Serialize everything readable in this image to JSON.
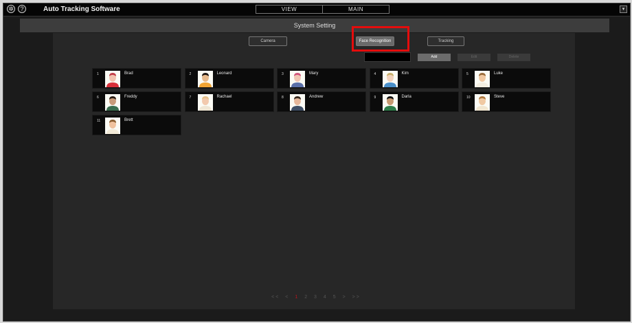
{
  "app": {
    "title": "Auto Tracking Software",
    "icons": [
      "gear-icon",
      "help-icon"
    ],
    "close_glyph": "▾"
  },
  "mode_tabs": [
    "VIEW",
    "MAIN"
  ],
  "subheader": "System Setting",
  "setting_tabs": [
    "Camera",
    "Face Recognition",
    "Tracking"
  ],
  "selected_setting_tab": "Face Recognition",
  "highlight_color": "#e50c0c",
  "search": {
    "value": "",
    "placeholder": ""
  },
  "actions": [
    "Add",
    "Edit",
    "Delete"
  ],
  "faces": [
    {
      "num": "1",
      "name": "Brad",
      "shirt": "#d8303a",
      "skin": "#f2c3b0",
      "hair": "#c23b47"
    },
    {
      "num": "2",
      "name": "Leonard",
      "shirt": "#f1a433",
      "skin": "#e7b98b",
      "hair": "#1c1410"
    },
    {
      "num": "3",
      "name": "Mary",
      "shirt": "#5a6fa8",
      "skin": "#f0c5b3",
      "hair": "#d0527a"
    },
    {
      "num": "4",
      "name": "Kim",
      "shirt": "#4a8fc9",
      "skin": "#f3d3bd",
      "hair": "#c9b06b"
    },
    {
      "num": "5",
      "name": "Luke",
      "shirt": "#f3eee2",
      "skin": "#f1c9a3",
      "hair": "#9a6b3a"
    },
    {
      "num": "6",
      "name": "Freddy",
      "shirt": "#3a6e4f",
      "skin": "#c99b7a",
      "hair": "#2b1d14"
    },
    {
      "num": "7",
      "name": "Rachael",
      "shirt": "#efe6d4",
      "skin": "#f2c9ad",
      "hair": "#e6c08a"
    },
    {
      "num": "8",
      "name": "Andrew",
      "shirt": "#3f4f66",
      "skin": "#e6b89c",
      "hair": "#3a2b20"
    },
    {
      "num": "9",
      "name": "Darla",
      "shirt": "#2e7d4a",
      "skin": "#c79a72",
      "hair": "#111111"
    },
    {
      "num": "10",
      "name": "Steve",
      "shirt": "#f1e6d0",
      "skin": "#f0c9a3",
      "hair": "#b07a42"
    },
    {
      "num": "11",
      "name": "Brett",
      "shirt": "#f2ead7",
      "skin": "#f0c29e",
      "hair": "#8a5d2e"
    }
  ],
  "pagination": {
    "first": "<<",
    "prev": "<",
    "pages": [
      "1",
      "2",
      "3",
      "4",
      "5"
    ],
    "current": "1",
    "next": ">",
    "last": ">>"
  }
}
